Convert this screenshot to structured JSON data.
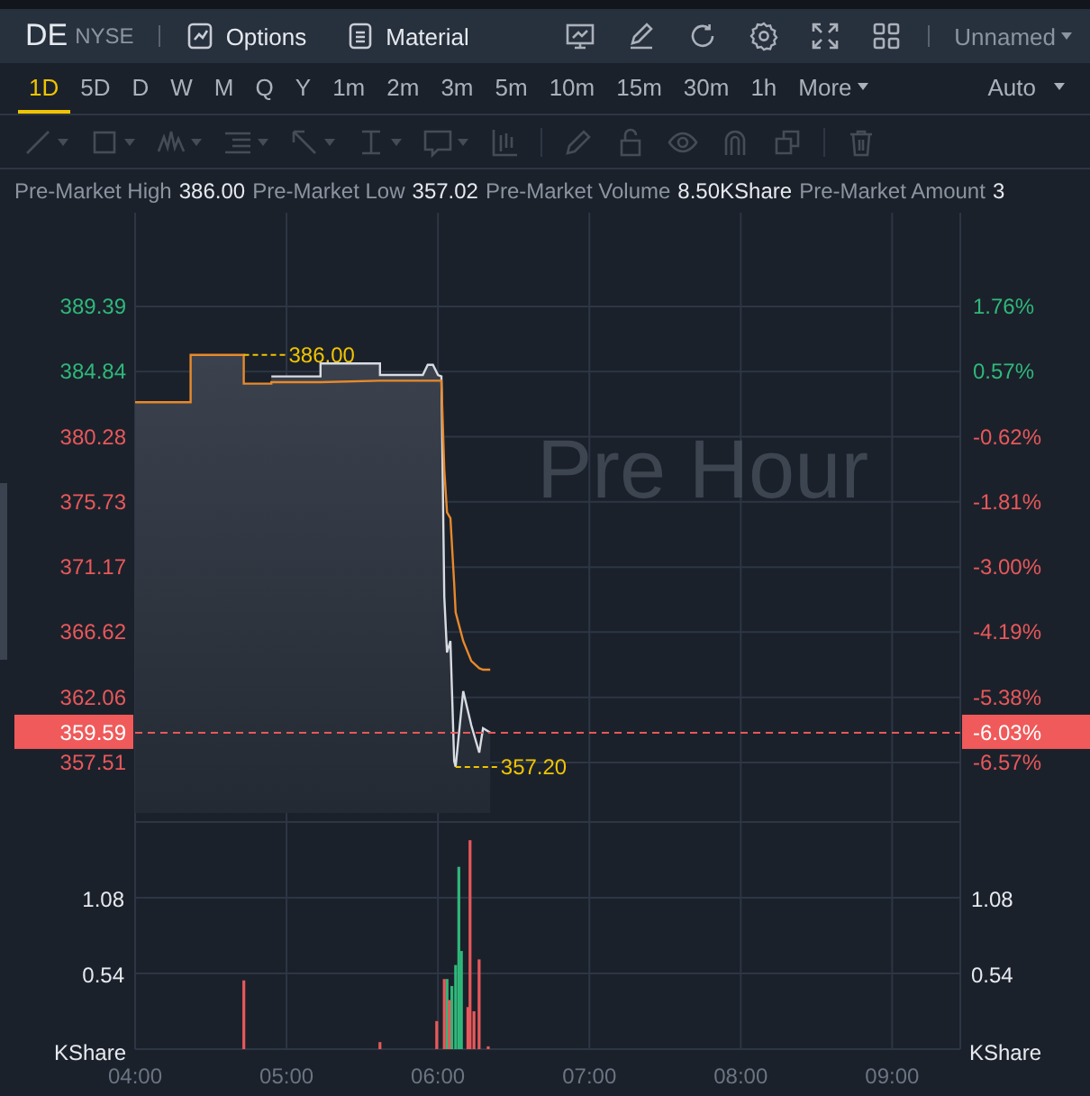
{
  "header": {
    "symbol": "DE",
    "exchange": "NYSE",
    "links": [
      {
        "kind": "options",
        "label": "Options"
      },
      {
        "kind": "material",
        "label": "Material"
      }
    ],
    "layout_name": "Unnamed"
  },
  "intervals": [
    {
      "label": "1D",
      "selected": true
    },
    {
      "label": "5D",
      "selected": false
    },
    {
      "label": "D",
      "selected": false
    },
    {
      "label": "W",
      "selected": false
    },
    {
      "label": "M",
      "selected": false
    },
    {
      "label": "Q",
      "selected": false
    },
    {
      "label": "Y",
      "selected": false
    },
    {
      "label": "1m",
      "selected": false
    },
    {
      "label": "2m",
      "selected": false
    },
    {
      "label": "3m",
      "selected": false
    },
    {
      "label": "5m",
      "selected": false
    },
    {
      "label": "10m",
      "selected": false
    },
    {
      "label": "15m",
      "selected": false
    },
    {
      "label": "30m",
      "selected": false
    },
    {
      "label": "1h",
      "selected": false
    }
  ],
  "more_label": "More",
  "scale_mode": "Auto",
  "drawing_tools": [
    {
      "kind": "line",
      "menu": true,
      "disabled": true
    },
    {
      "kind": "rect",
      "menu": true,
      "disabled": true
    },
    {
      "kind": "wave",
      "menu": true,
      "disabled": true
    },
    {
      "kind": "fib",
      "menu": true,
      "disabled": true
    },
    {
      "kind": "arrow",
      "menu": true,
      "disabled": true
    },
    {
      "kind": "vline",
      "menu": true,
      "disabled": true
    },
    {
      "kind": "text",
      "menu": true,
      "disabled": true
    },
    {
      "kind": "candles",
      "menu": false,
      "disabled": true
    },
    {
      "kind": "sep"
    },
    {
      "kind": "pencil",
      "menu": false,
      "disabled": true
    },
    {
      "kind": "lock",
      "menu": false,
      "disabled": true
    },
    {
      "kind": "eye",
      "menu": false,
      "disabled": true
    },
    {
      "kind": "magnet",
      "menu": false,
      "disabled": true
    },
    {
      "kind": "copy",
      "menu": false,
      "disabled": true
    },
    {
      "kind": "sep"
    },
    {
      "kind": "trash",
      "menu": false,
      "disabled": true
    }
  ],
  "stats": [
    {
      "label": "Pre-Market High",
      "value": "386.00"
    },
    {
      "label": "Pre-Market Low",
      "value": "357.02"
    },
    {
      "label": "Pre-Market Volume",
      "value": "8.50KShare"
    },
    {
      "label": "Pre-Market Amount",
      "value": "3"
    }
  ],
  "price_chart": {
    "watermark": "Pre Hour",
    "chart_data": {
      "type": "line",
      "grid": true,
      "x": [
        4,
        4.367,
        4.367,
        4.717,
        4.717,
        4.9,
        4.9,
        5.225,
        5.225,
        5.617,
        5.617,
        5.9,
        5.933,
        5.967,
        6,
        6.023,
        6.042,
        6.06,
        6.083,
        6.107,
        6.117,
        6.167,
        6.22,
        6.273,
        6.298,
        6.345
      ],
      "series": [
        {
          "color": "#d8dce2",
          "values": [
            null,
            null,
            null,
            null,
            null,
            null,
            384.5,
            384.5,
            385.4,
            385.4,
            384.6,
            384.6,
            385.3,
            385.3,
            384.6,
            384.5,
            369.1,
            365.2,
            366.0,
            357.6,
            357.2,
            362.5,
            360.1,
            358.2,
            359.9,
            359.6
          ]
        },
        {
          "color": "#e8892b",
          "values": [
            382.7,
            382.7,
            386.0,
            386.0,
            384.0,
            384.0,
            384.1,
            384.1,
            384.1,
            384.2,
            384.2,
            384.2,
            384.2,
            384.2,
            384.2,
            384.2,
            378,
            375,
            374.6,
            370,
            368,
            366,
            364.6,
            364.1,
            364.0,
            364.0
          ]
        }
      ],
      "xlim": [
        4,
        9.45
      ],
      "ylim": [
        353.98,
        395.94
      ],
      "yticks": [
        {
          "value": 389.39,
          "label": "389.39"
        },
        {
          "value": 384.84,
          "label": "384.84"
        },
        {
          "value": 380.28,
          "label": "380.28"
        },
        {
          "value": 375.73,
          "label": "375.73"
        },
        {
          "value": 371.17,
          "label": "371.17"
        },
        {
          "value": 366.62,
          "label": "366.62"
        },
        {
          "value": 362.06,
          "label": "362.06"
        },
        {
          "value": 357.51,
          "label": "357.51"
        }
      ],
      "ref_lines": [
        {
          "axis": "y",
          "value": 359.59,
          "label": "359.59",
          "color": "#e8585a"
        }
      ],
      "annotations": [
        {
          "x": 4.717,
          "y": 386.0,
          "text": "386.00"
        },
        {
          "x": 6.117,
          "y": 357.2,
          "text": "357.20"
        }
      ]
    },
    "right_ticks": [
      {
        "label": "1.76%",
        "color": "#2fb87a"
      },
      {
        "label": "0.57%",
        "color": "#2fb87a"
      },
      {
        "label": "-0.62%",
        "color": "#e8585a"
      },
      {
        "label": "-1.81%",
        "color": "#e8585a"
      },
      {
        "label": "-3.00%",
        "color": "#e8585a"
      },
      {
        "label": "-4.19%",
        "color": "#e8585a"
      },
      {
        "label": "-5.38%",
        "color": "#e8585a"
      },
      {
        "label": "-6.57%",
        "color": "#e8585a"
      }
    ],
    "current": {
      "change": "-6.03%"
    }
  },
  "volume_chart": {
    "unit_left": "KShare",
    "unit_right": "KShare",
    "chart_data": {
      "type": "bar",
      "grid": true,
      "x": [
        4.718,
        5.617,
        5.992,
        6.042,
        6.06,
        6.075,
        6.092,
        6.117,
        6.138,
        6.155,
        6.198,
        6.212,
        6.238,
        6.272,
        6.332
      ],
      "series": [
        {
          "color": "#2fb87a",
          "values": [
            null,
            null,
            null,
            null,
            0.5,
            null,
            0.45,
            0.6,
            1.3,
            0.7,
            null,
            null,
            null,
            null,
            null
          ]
        },
        {
          "color": "#e8585a",
          "values": [
            0.49,
            0.05,
            0.2,
            0.5,
            null,
            0.35,
            null,
            null,
            null,
            null,
            0.3,
            1.49,
            0.27,
            0.64,
            0.02
          ]
        }
      ],
      "xlim": [
        4,
        9.45
      ],
      "ylim": [
        0,
        1.684
      ],
      "yticks": [
        {
          "value": 0.54,
          "label": "0.54"
        },
        {
          "value": 1.08,
          "label": "1.08"
        }
      ],
      "xticks": [
        {
          "value": 4,
          "label": "04:00"
        },
        {
          "value": 5,
          "label": "05:00"
        },
        {
          "value": 6,
          "label": "06:00"
        },
        {
          "value": 7,
          "label": "07:00"
        },
        {
          "value": 8,
          "label": "08:00"
        },
        {
          "value": 9,
          "label": "09:00"
        }
      ]
    }
  }
}
